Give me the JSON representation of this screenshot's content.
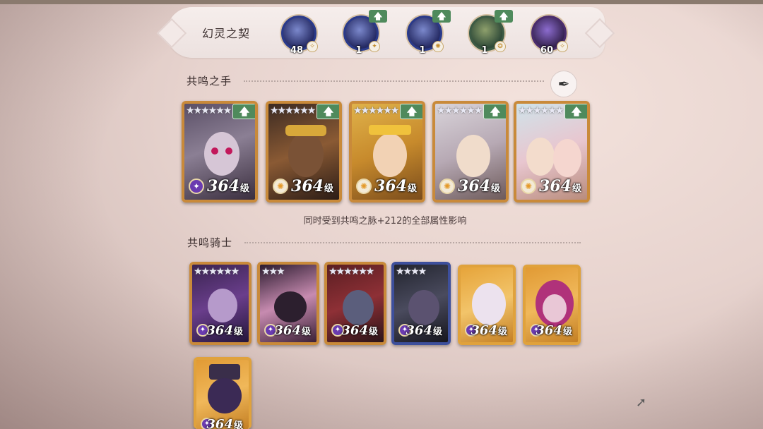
{
  "header": {
    "title": "幻灵之契",
    "orbs": [
      {
        "count": "48",
        "has_upgrade": false,
        "badge": "✧",
        "theme": "blue"
      },
      {
        "count": "1",
        "has_upgrade": true,
        "badge": "✦",
        "theme": "blue"
      },
      {
        "count": "1",
        "has_upgrade": true,
        "badge": "✺",
        "theme": "blue"
      },
      {
        "count": "1",
        "has_upgrade": true,
        "badge": "❂",
        "theme": "green"
      },
      {
        "count": "60",
        "has_upgrade": false,
        "badge": "✧",
        "theme": "purple"
      }
    ],
    "upgrade_symbol": "🡅"
  },
  "resonance_hand": {
    "label": "共鸣之手",
    "note": "同时受到共鸣之脉+212的全部属性影响",
    "quill_icon": "✒",
    "cards": [
      {
        "stars": "★★★★★★",
        "level": "364",
        "unit": "级",
        "element": "dark",
        "art": "pale-horned",
        "upgrade": true
      },
      {
        "stars": "★★★★★★",
        "level": "364",
        "unit": "级",
        "element": "light",
        "art": "golden-king",
        "upgrade": true
      },
      {
        "stars": "★★★★★★",
        "level": "364",
        "unit": "级",
        "element": "light",
        "art": "blond-crown",
        "upgrade": true
      },
      {
        "stars": "★★★★★★",
        "level": "364",
        "unit": "级",
        "element": "light",
        "art": "silver-hair",
        "upgrade": true
      },
      {
        "stars": "★★★★★★",
        "level": "364",
        "unit": "级",
        "element": "light",
        "art": "twins",
        "upgrade": true
      }
    ]
  },
  "resonance_knight": {
    "label": "共鸣骑士",
    "cards": [
      {
        "stars": "★★★★★★",
        "level": "364",
        "unit": "级",
        "element": "dark",
        "art": "imp"
      },
      {
        "stars": "★★★",
        "level": "364",
        "unit": "级",
        "element": "dark",
        "art": "masked"
      },
      {
        "stars": "★★★★★★",
        "level": "364",
        "unit": "级",
        "element": "dark",
        "art": "demon-lord"
      },
      {
        "stars": "★★★★",
        "level": "364",
        "unit": "级",
        "element": "dark",
        "art": "armored"
      },
      {
        "stars": "",
        "level": "364",
        "unit": "级",
        "element": "dark",
        "art": "pale-witch"
      },
      {
        "stars": "",
        "level": "364",
        "unit": "级",
        "element": "dark",
        "art": "pink-demon"
      },
      {
        "stars": "",
        "level": "364",
        "unit": "级",
        "element": "dark",
        "art": "shadow-hat"
      }
    ]
  },
  "colors": {
    "upgrade_green": "#4f8a5c",
    "card_border": "#c98a3a",
    "dark_element": "#6a3bb0"
  }
}
